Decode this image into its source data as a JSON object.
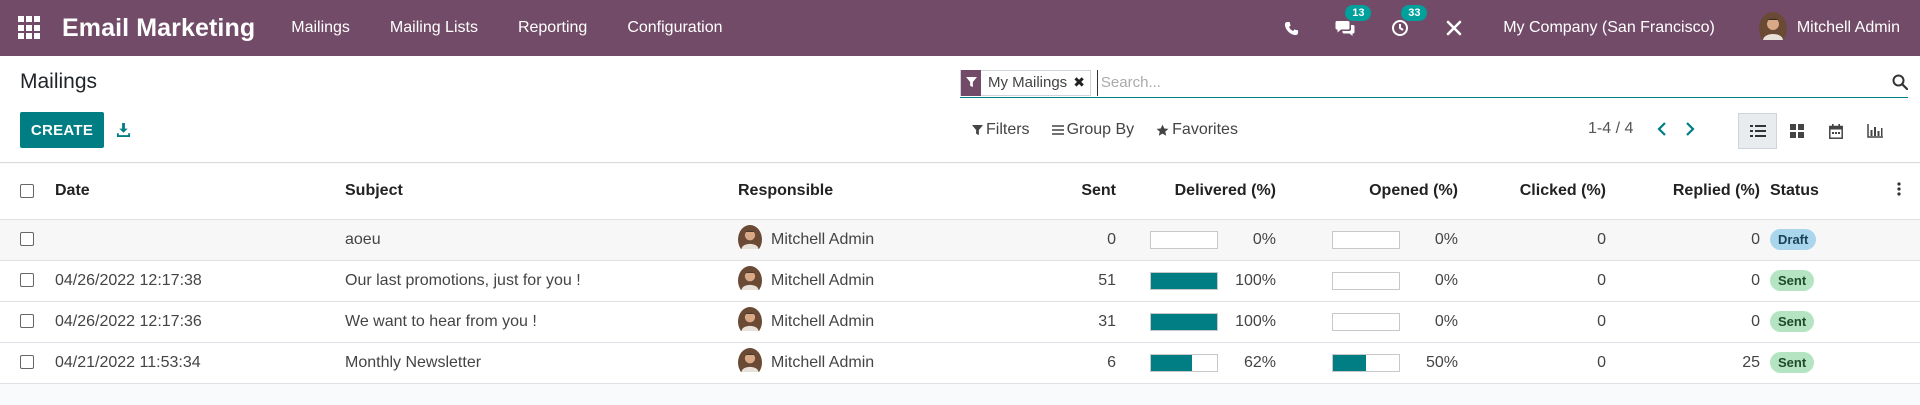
{
  "app": {
    "title": "Email Marketing",
    "menu": [
      "Mailings",
      "Mailing Lists",
      "Reporting",
      "Configuration"
    ],
    "messages_count": "13",
    "activities_count": "33",
    "company": "My Company (San Francisco)",
    "user": "Mitchell Admin",
    "navbar_color": "#714b67"
  },
  "page": {
    "title": "Mailings",
    "create_label": "CREATE"
  },
  "search": {
    "facet": "My Mailings",
    "placeholder": "Search..."
  },
  "filters": {
    "filters_label": "Filters",
    "groupby_label": "Group By",
    "favorites_label": "Favorites"
  },
  "pager": {
    "text": "1-4 / 4"
  },
  "table": {
    "headers": {
      "date": "Date",
      "subject": "Subject",
      "responsible": "Responsible",
      "sent": "Sent",
      "delivered": "Delivered (%)",
      "opened": "Opened (%)",
      "clicked": "Clicked (%)",
      "replied": "Replied (%)",
      "status": "Status"
    },
    "rows": [
      {
        "date": "",
        "subject": "aoeu",
        "responsible": "Mitchell Admin",
        "sent": "0",
        "delivered": "0%",
        "delivered_value": 0,
        "opened": "0%",
        "opened_value": 0,
        "clicked": "0",
        "replied": "0",
        "status": "Draft"
      },
      {
        "date": "04/26/2022 12:17:38",
        "subject": "Our last promotions, just for you !",
        "responsible": "Mitchell Admin",
        "sent": "51",
        "delivered": "100%",
        "delivered_value": 100,
        "opened": "0%",
        "opened_value": 0,
        "clicked": "0",
        "replied": "0",
        "status": "Sent"
      },
      {
        "date": "04/26/2022 12:17:36",
        "subject": "We want to hear from you !",
        "responsible": "Mitchell Admin",
        "sent": "31",
        "delivered": "100%",
        "delivered_value": 100,
        "opened": "0%",
        "opened_value": 0,
        "clicked": "0",
        "replied": "0",
        "status": "Sent"
      },
      {
        "date": "04/21/2022 11:53:34",
        "subject": "Monthly Newsletter",
        "responsible": "Mitchell Admin",
        "sent": "6",
        "delivered": "62%",
        "delivered_value": 62,
        "opened": "50%",
        "opened_value": 50,
        "clicked": "0",
        "replied": "25",
        "status": "Sent"
      }
    ]
  }
}
